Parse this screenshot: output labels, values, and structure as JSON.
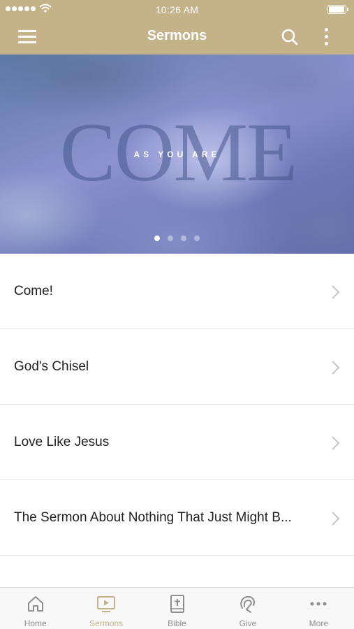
{
  "status_bar": {
    "time": "10:26 AM"
  },
  "header": {
    "title": "Sermons"
  },
  "banner": {
    "word": "COME",
    "subtitle": "AS YOU ARE",
    "page_count": 4,
    "active_page": 1
  },
  "sermons": [
    {
      "title": "Come!"
    },
    {
      "title": "God's Chisel"
    },
    {
      "title": "Love Like Jesus"
    },
    {
      "title": "The Sermon About Nothing That Just Might B..."
    }
  ],
  "tabs": [
    {
      "label": "Home",
      "icon": "home-icon",
      "active": false
    },
    {
      "label": "Sermons",
      "icon": "video-icon",
      "active": true
    },
    {
      "label": "Bible",
      "icon": "bible-icon",
      "active": false
    },
    {
      "label": "Give",
      "icon": "give-icon",
      "active": false
    },
    {
      "label": "More",
      "icon": "more-icon",
      "active": false
    }
  ],
  "colors": {
    "brand": "#c4b288",
    "tab_inactive": "#8e8e8e",
    "list_divider": "#e4e4e4"
  }
}
